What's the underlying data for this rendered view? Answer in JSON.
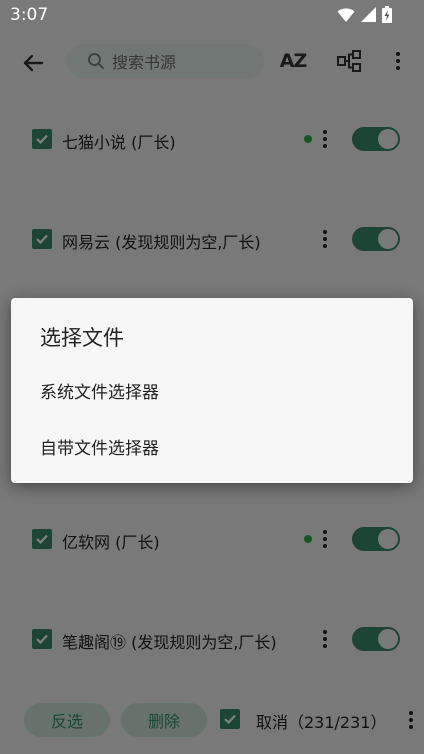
{
  "status_bar": {
    "time": "3:07"
  },
  "toolbar": {
    "search_placeholder": "搜索书源",
    "sort_icon_label": "AZ"
  },
  "sources": [
    {
      "name": "七猫小说 (厂长)",
      "checked": true,
      "dot": true,
      "enabled": true
    },
    {
      "name": "网易云 (发现规则为空,厂长)",
      "checked": true,
      "dot": false,
      "enabled": true
    },
    {
      "name": "亿软网 (厂长)",
      "checked": true,
      "dot": true,
      "enabled": true
    },
    {
      "name": "笔趣阁⑲ (发现规则为空,厂长)",
      "checked": true,
      "dot": false,
      "enabled": true
    }
  ],
  "bottom_bar": {
    "invert_label": "反选",
    "delete_label": "删除",
    "cancel_label": "取消（231/231）"
  },
  "dialog": {
    "title": "选择文件",
    "options": [
      "系统文件选择器",
      "自带文件选择器"
    ]
  },
  "colors": {
    "accent": "#3a8a6a",
    "dot": "#2ea84a",
    "scrim": "rgba(0,0,0,0.5)"
  }
}
